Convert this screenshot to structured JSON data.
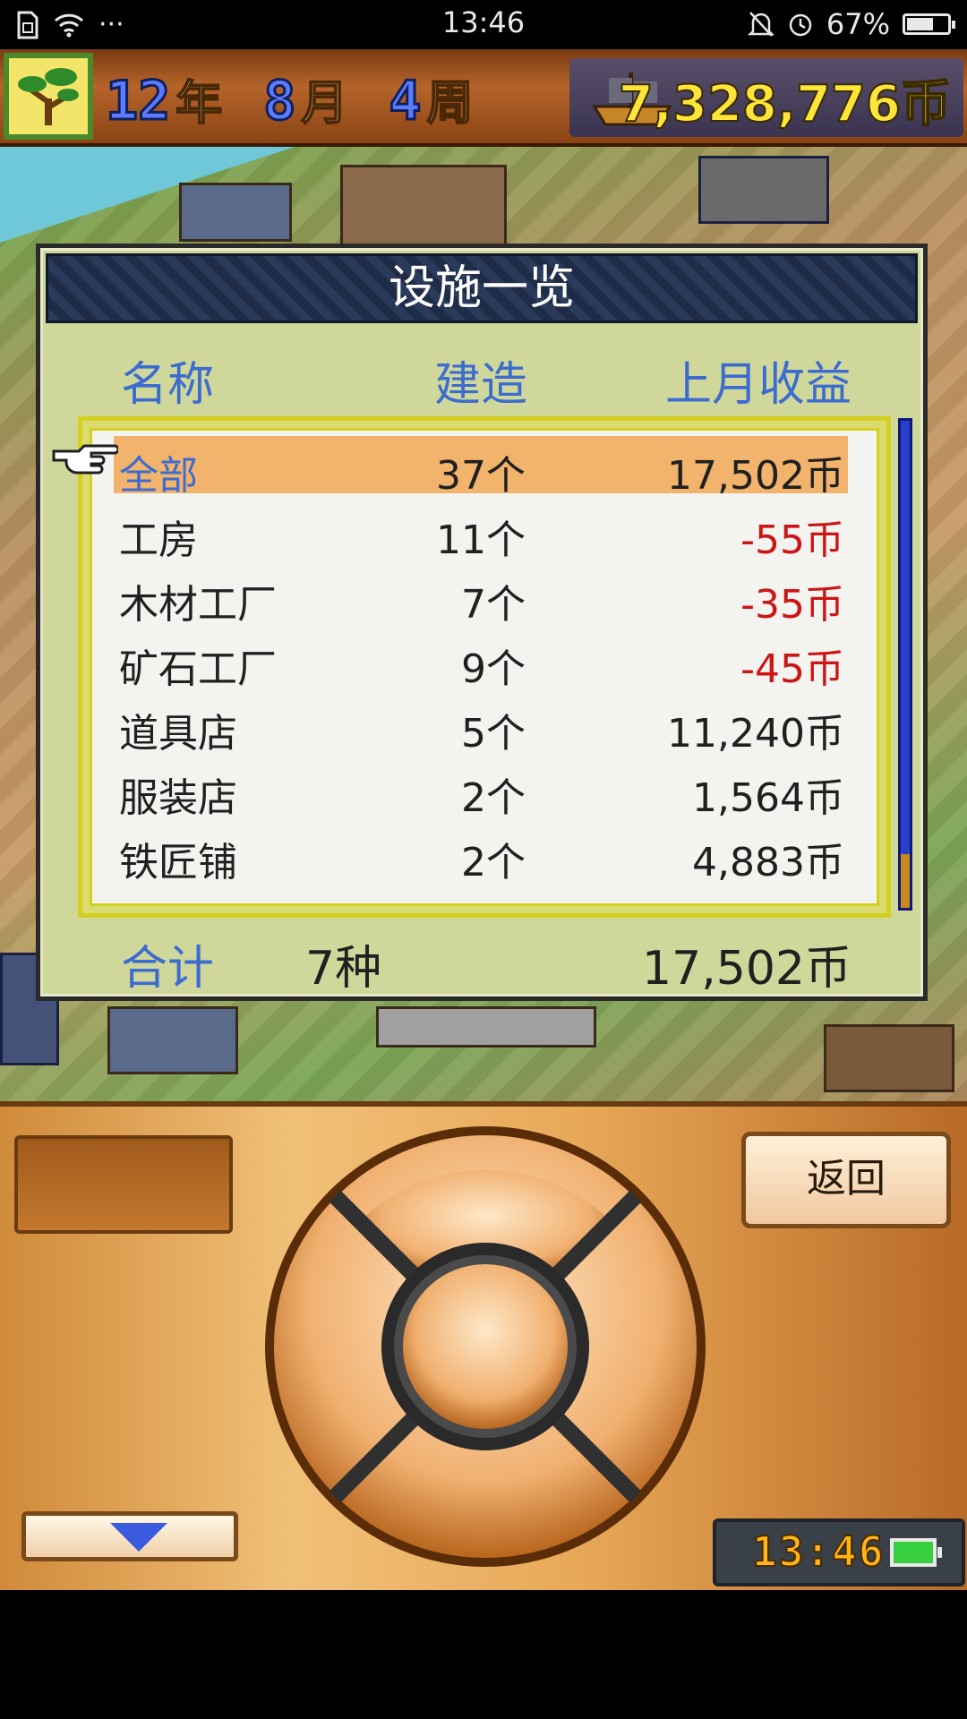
{
  "status_bar": {
    "time": "13:46",
    "battery": "67%",
    "battery_level": 0.67,
    "dots": "···"
  },
  "header": {
    "year": "12",
    "year_unit": "年",
    "month": "8",
    "month_unit": "月",
    "week": "4",
    "week_unit": "周",
    "money": "7,328,776币",
    "tree_icon": "bonsai-tree-icon",
    "ship_icon": "ship-icon"
  },
  "dialog": {
    "title": "设施一览",
    "columns": {
      "name": "名称",
      "built": "建造",
      "revenue": "上月收益"
    },
    "rows": [
      {
        "name": "全部",
        "count": "37个",
        "revenue": "17,502币",
        "negative": false,
        "selected": true
      },
      {
        "name": "工房",
        "count": "11个",
        "revenue": "-55币",
        "negative": true,
        "selected": false
      },
      {
        "name": "木材工厂",
        "count": "7个",
        "revenue": "-35币",
        "negative": true,
        "selected": false
      },
      {
        "name": "矿石工厂",
        "count": "9个",
        "revenue": "-45币",
        "negative": true,
        "selected": false
      },
      {
        "name": "道具店",
        "count": "5个",
        "revenue": "11,240币",
        "negative": false,
        "selected": false
      },
      {
        "name": "服装店",
        "count": "2个",
        "revenue": "1,564币",
        "negative": false,
        "selected": false
      },
      {
        "name": "铁匠铺",
        "count": "2个",
        "revenue": "4,883币",
        "negative": false,
        "selected": false
      }
    ],
    "total": {
      "label": "合计",
      "kinds": "7种",
      "revenue": "17,502币"
    }
  },
  "controls": {
    "back_label": "返回",
    "clock": "13:46"
  },
  "colors": {
    "accent_blue": "#3d6cd0",
    "negative_red": "#cc1515",
    "selected_row": "#f2b36c",
    "money_yellow": "#ffe43a"
  }
}
